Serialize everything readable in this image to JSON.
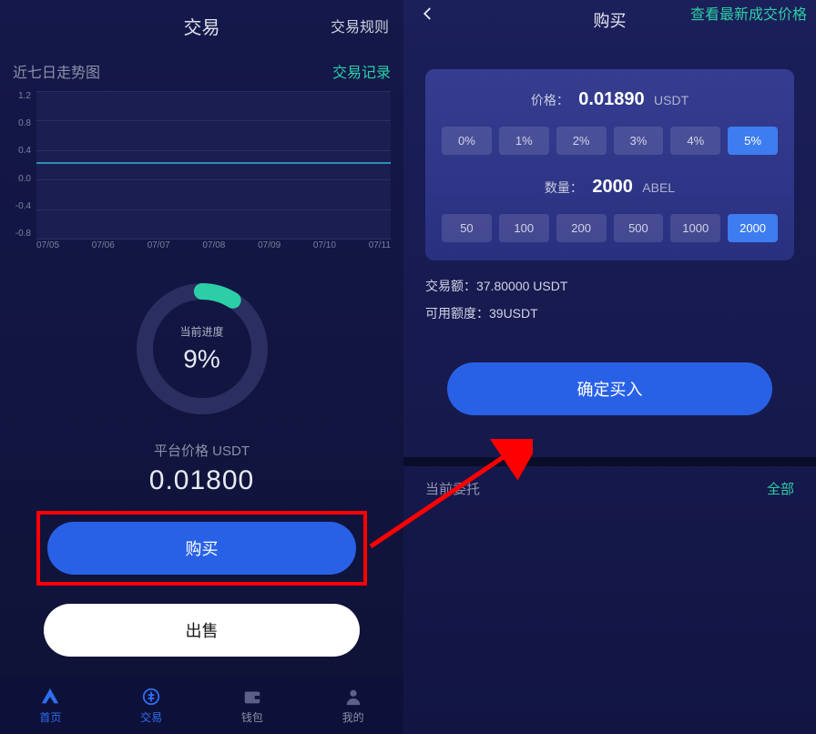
{
  "left": {
    "header": {
      "title": "交易",
      "rules": "交易规则"
    },
    "trend": {
      "label": "近七日走势图",
      "log": "交易记录"
    },
    "chart_data": {
      "type": "line",
      "title": "近七日走势图",
      "y_ticks": [
        "1.2",
        "0.8",
        "0.4",
        "0.0",
        "-0.4",
        "-0.8"
      ],
      "x_ticks": [
        "07/05",
        "07/06",
        "07/07",
        "07/08",
        "07/09",
        "07/10",
        "07/11"
      ],
      "ylim": [
        -0.8,
        1.2
      ],
      "x": [
        "07/05",
        "07/06",
        "07/07",
        "07/08",
        "07/09",
        "07/10",
        "07/11"
      ],
      "values": [
        0.018,
        0.018,
        0.018,
        0.018,
        0.018,
        0.018,
        0.018
      ]
    },
    "progress": {
      "label": "当前进度",
      "percent": "9%",
      "value": 9
    },
    "price": {
      "label": "平台价格 USDT",
      "value": "0.01800"
    },
    "buttons": {
      "buy": "购买",
      "sell": "出售"
    },
    "tabbar": [
      {
        "label": "首页",
        "active": true,
        "icon": "home"
      },
      {
        "label": "交易",
        "active": true,
        "icon": "trade"
      },
      {
        "label": "钱包",
        "active": false,
        "icon": "wallet"
      },
      {
        "label": "我的",
        "active": false,
        "icon": "mine"
      }
    ]
  },
  "right": {
    "header": {
      "title": "购买",
      "link": "查看最新成交价格"
    },
    "card": {
      "price_label": "价格：",
      "price_value": "0.01890",
      "price_unit": "USDT",
      "percent_options": [
        "0%",
        "1%",
        "2%",
        "3%",
        "4%",
        "5%"
      ],
      "percent_selected": 5,
      "qty_label": "数量：",
      "qty_value": "2000",
      "qty_unit": "ABEL",
      "qty_options": [
        "50",
        "100",
        "200",
        "500",
        "1000",
        "2000"
      ],
      "qty_selected": 5
    },
    "info": {
      "amount_label": "交易额：",
      "amount_value": "37.80000 USDT",
      "avail_label": "可用额度：",
      "avail_value": "39USDT"
    },
    "confirm": "确定买入",
    "orders": {
      "label": "当前委托",
      "all": "全部"
    }
  }
}
